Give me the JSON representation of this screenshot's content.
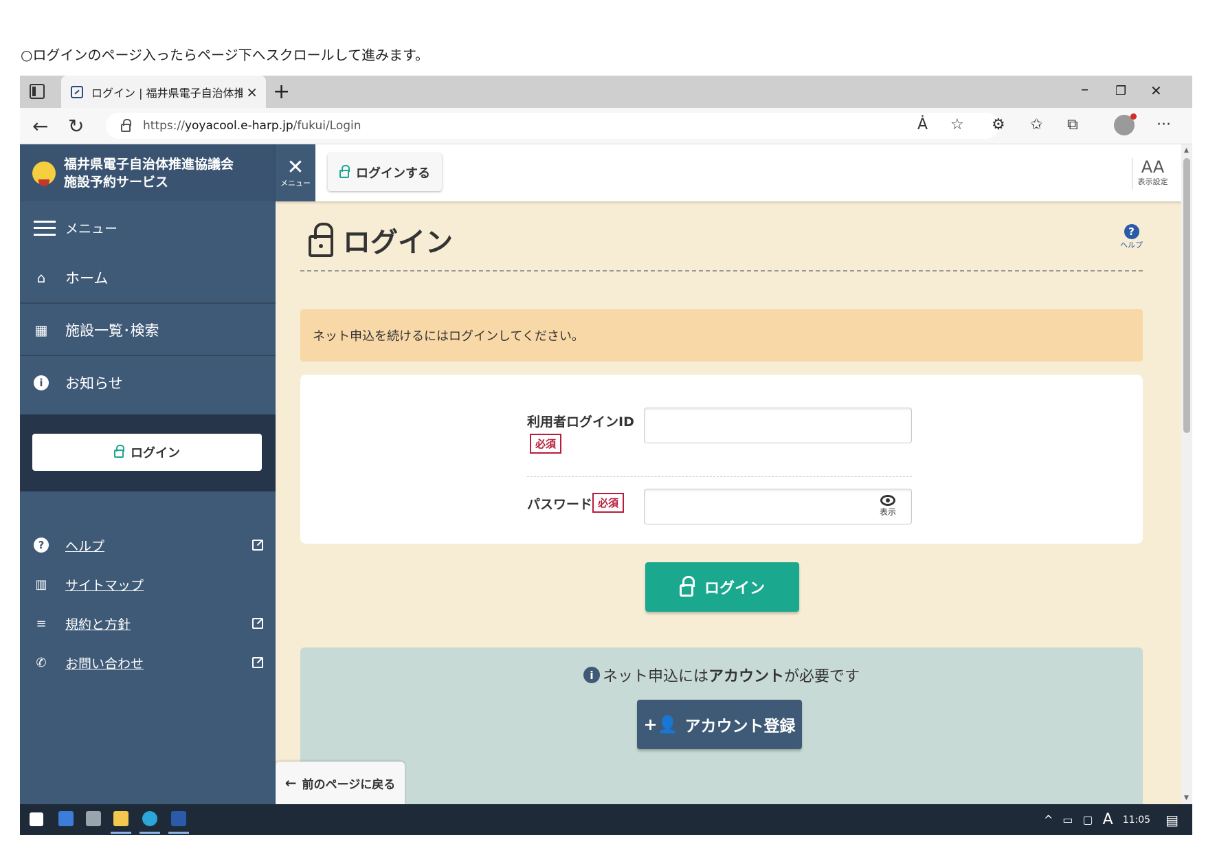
{
  "instruction": "○ログインのページ入ったらページ下へスクロールして進みます。",
  "browser": {
    "tab_title": "ログイン | 福井県電子自治体推進",
    "tab_close": "×",
    "new_tab": "+",
    "url_scheme": "https://",
    "url_host": "yoyacool.e-harp.jp",
    "url_path": "/fukui/Login",
    "win_min": "–",
    "win_restore": "❐",
    "win_close": "✕",
    "back": "←",
    "reload": "↻",
    "read_aloud": "Ȧ",
    "favorites_add": "☆",
    "extensions": "⚙",
    "favorites": "✩",
    "collections": "⧉",
    "more": "···"
  },
  "sidebar": {
    "brand_line1": "福井県電子自治体推進協議会",
    "brand_line2": "施設予約サービス",
    "menu_label": "メニュー",
    "nav": [
      {
        "label": "ホーム",
        "icon": "⌂"
      },
      {
        "label": "施設一覧･検索",
        "icon": "▦"
      },
      {
        "label": "お知らせ",
        "icon": "i"
      }
    ],
    "login_label": "ログイン",
    "links": [
      {
        "label": "ヘルプ",
        "icon": "?"
      },
      {
        "label": "サイトマップ",
        "icon": "▥"
      },
      {
        "label": "規約と方針",
        "icon": "≡"
      },
      {
        "label": "お問い合わせ",
        "icon": "✆"
      }
    ]
  },
  "header": {
    "close_x": "✕",
    "close_label": "メニュー",
    "login_label": "ログインする",
    "text_size_glyph": "AA",
    "text_size_label": "表示設定"
  },
  "main": {
    "title": "ログイン",
    "help_glyph": "?",
    "help_label": "ヘルプ",
    "notice": "ネット申込を続けるにはログインしてください。",
    "id_label": "利用者ログインID",
    "required": "必須",
    "password_label": "パスワード",
    "show_label": "表示",
    "login_button": "ログイン",
    "account_msg_pre": "ネット申込には",
    "account_msg_bold": "アカウント",
    "account_msg_post": "が必要です",
    "account_button": "アカウント登録",
    "back_button": "前のページに戻る"
  },
  "taskbar": {
    "clock": "11:05",
    "tray_up": "^",
    "tray_ime": "A"
  },
  "colors": {
    "sidebar": "#3f5a77",
    "page_bg": "#f7ecd4",
    "notice_bg": "#f8d8a6",
    "login_btn": "#1aa88f",
    "account_bg": "#c8dad5",
    "required": "#b71c3a"
  }
}
